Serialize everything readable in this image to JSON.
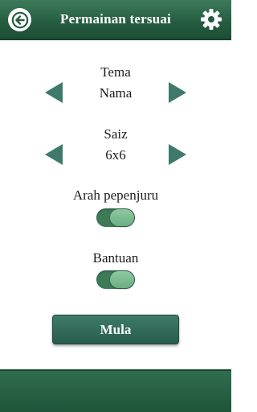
{
  "header": {
    "title": "Permainan tersuai",
    "back_icon": "back-arrow-icon",
    "settings_icon": "gear-icon"
  },
  "theme": {
    "label": "Tema",
    "value": "Nama",
    "prev_icon": "triangle-left-icon",
    "next_icon": "triangle-right-icon"
  },
  "size": {
    "label": "Saiz",
    "value": "6x6",
    "prev_icon": "triangle-left-icon",
    "next_icon": "triangle-right-icon"
  },
  "diagonal": {
    "label": "Arah pepenjuru",
    "enabled": true
  },
  "help": {
    "label": "Bantuan",
    "enabled": true
  },
  "start_button": {
    "label": "Mula"
  },
  "colors": {
    "header": "#255c40",
    "accent": "#3c7a58",
    "arrow": "#3e7a6c",
    "toggle_knob": "#8fc9a2",
    "button": "#326b5b"
  }
}
